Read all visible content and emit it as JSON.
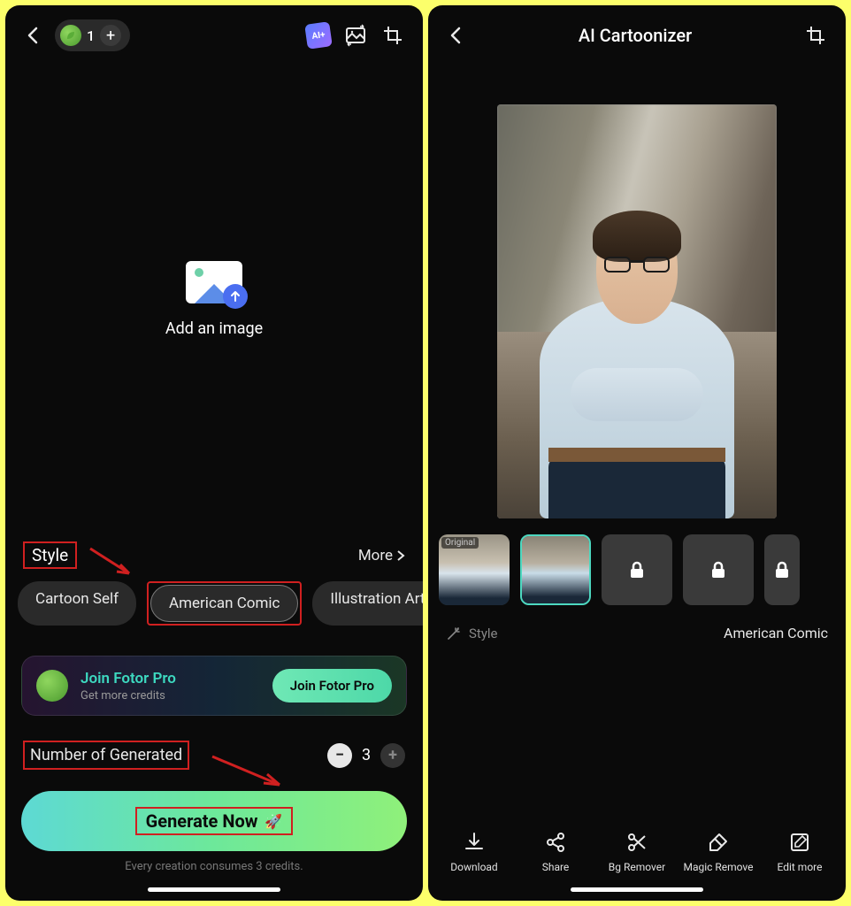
{
  "left": {
    "credit_count": "1",
    "upload_label": "Add an image",
    "style_section_label": "Style",
    "more_label": "More",
    "styles": [
      "Cartoon Self",
      "American Comic",
      "Illustration Art"
    ],
    "pro": {
      "title": "Join Fotor Pro",
      "sub": "Get more credits",
      "cta": "Join Fotor Pro"
    },
    "num_label": "Number of Generated",
    "num_value": "3",
    "generate_label": "Generate Now",
    "credits_note": "Every creation consumes 3 credits."
  },
  "right": {
    "title": "AI Cartoonizer",
    "thumb_original": "Original",
    "style_label": "Style",
    "style_value": "American Comic",
    "actions": {
      "download": "Download",
      "share": "Share",
      "bgremover": "Bg Remover",
      "magicremove": "Magic Remove",
      "editmore": "Edit more"
    }
  }
}
